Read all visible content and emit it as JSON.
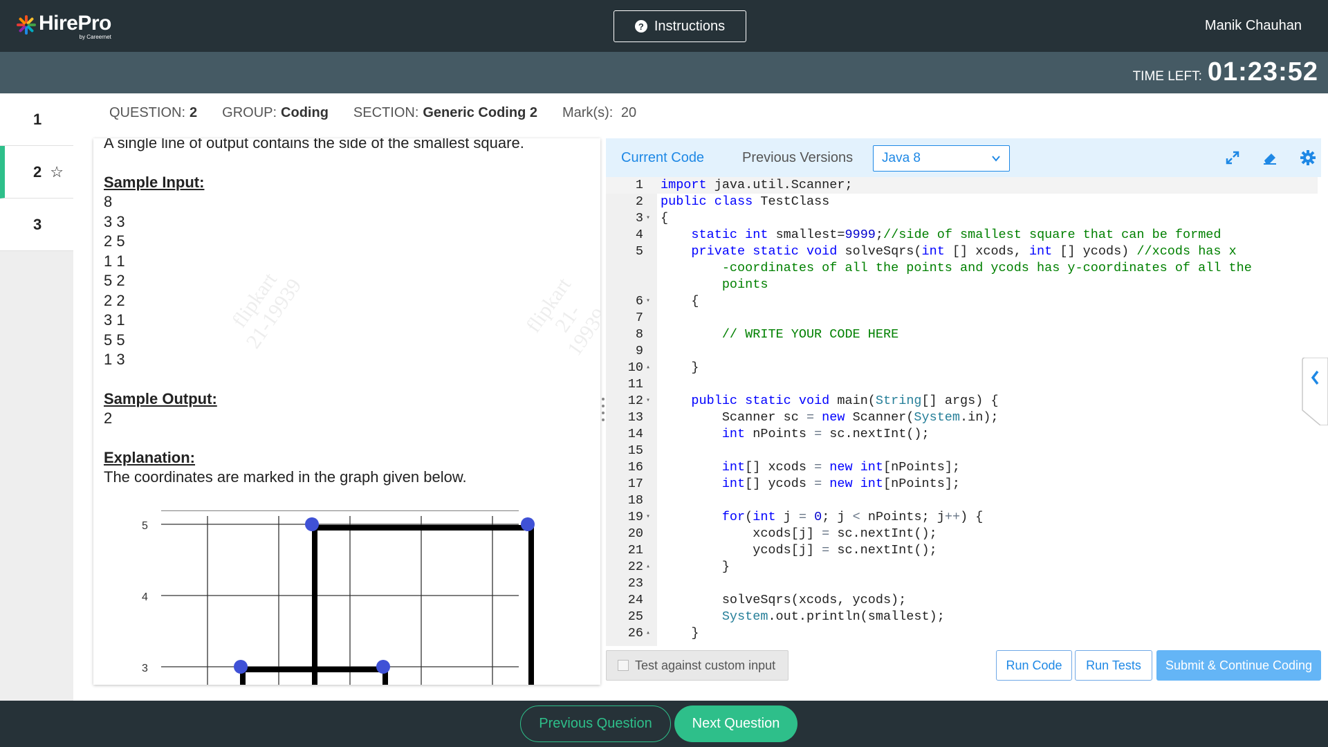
{
  "header": {
    "brand": "HirePro",
    "brand_sub": "by Careernet",
    "instructions_label": "Instructions",
    "user_name": "Manik Chauhan"
  },
  "timer": {
    "label": "TIME LEFT:",
    "value": "01:23:52"
  },
  "question_nav": {
    "items": [
      "1",
      "2",
      "3"
    ],
    "active": "2"
  },
  "meta": {
    "question_label": "QUESTION:",
    "question_value": "2",
    "group_label": "GROUP:",
    "group_value": "Coding",
    "section_label": "SECTION:",
    "section_value": "Generic Coding 2",
    "marks_label": "Mark(s):",
    "marks_value": "20"
  },
  "problem": {
    "output_line": "A single line of output contains the side of the smallest square.",
    "sample_input_heading": "Sample Input:",
    "sample_input": [
      "8",
      "3 3",
      "2 5",
      "1 1",
      "5 2",
      "2 2",
      "3 1",
      "5 5",
      "1 3"
    ],
    "sample_output_heading": "Sample Output:",
    "sample_output": "2",
    "explanation_heading": "Explanation:",
    "explanation_text": "The coordinates are marked in the graph given below.",
    "watermark_line1": "flipkart",
    "watermark_line2": "21-19939",
    "graph_y_ticks": [
      "5",
      "4",
      "3"
    ]
  },
  "editor": {
    "tab_current": "Current Code",
    "tab_previous": "Previous Versions",
    "language": "Java 8",
    "lines": [
      {
        "n": "1",
        "fold": "",
        "html": "<span class=\"kw\">import</span> java.util.Scanner;"
      },
      {
        "n": "2",
        "fold": "",
        "html": "<span class=\"kw\">public class</span> TestClass"
      },
      {
        "n": "3",
        "fold": "▾",
        "html": "{"
      },
      {
        "n": "4",
        "fold": "",
        "html": "    <span class=\"kw\">static</span> <span class=\"typ\">int</span> smallest=<span class=\"num\">9999</span>;<span class=\"cm\">//side of smallest square that can be formed</span>"
      },
      {
        "n": "5",
        "fold": "",
        "html": "    <span class=\"kw\">private static</span> <span class=\"typ\">void</span> solveSqrs(<span class=\"typ\">int</span> [] xcods, <span class=\"typ\">int</span> [] ycods) <span class=\"cm\">//xcods has x</span>"
      },
      {
        "n": "",
        "fold": "",
        "html": "        <span class=\"cm\">-coordinates of all the points and ycods has y-coordinates of all the</span>"
      },
      {
        "n": "",
        "fold": "",
        "html": "        <span class=\"cm\">points</span>"
      },
      {
        "n": "6",
        "fold": "▾",
        "html": "    {"
      },
      {
        "n": "7",
        "fold": "",
        "html": ""
      },
      {
        "n": "8",
        "fold": "",
        "html": "        <span class=\"cm\">// WRITE YOUR CODE HERE</span>"
      },
      {
        "n": "9",
        "fold": "",
        "html": ""
      },
      {
        "n": "10",
        "fold": "▴",
        "html": "    }"
      },
      {
        "n": "11",
        "fold": "",
        "html": ""
      },
      {
        "n": "12",
        "fold": "▾",
        "html": "    <span class=\"kw\">public static</span> <span class=\"typ\">void</span> main(<span class=\"cls\">String</span>[] args) {"
      },
      {
        "n": "13",
        "fold": "",
        "html": "        Scanner sc <span class=\"op\">=</span> <span class=\"kw\">new</span> Scanner(<span class=\"cls\">System</span>.in);"
      },
      {
        "n": "14",
        "fold": "",
        "html": "        <span class=\"typ\">int</span> nPoints <span class=\"op\">=</span> sc.nextInt();"
      },
      {
        "n": "15",
        "fold": "",
        "html": ""
      },
      {
        "n": "16",
        "fold": "",
        "html": "        <span class=\"typ\">int</span>[] xcods <span class=\"op\">=</span> <span class=\"kw\">new</span> <span class=\"typ\">int</span>[nPoints];"
      },
      {
        "n": "17",
        "fold": "",
        "html": "        <span class=\"typ\">int</span>[] ycods <span class=\"op\">=</span> <span class=\"kw\">new</span> <span class=\"typ\">int</span>[nPoints];"
      },
      {
        "n": "18",
        "fold": "",
        "html": ""
      },
      {
        "n": "19",
        "fold": "▾",
        "html": "        <span class=\"kw\">for</span>(<span class=\"typ\">int</span> j <span class=\"op\">=</span> <span class=\"num\">0</span>; j <span class=\"op\">&lt;</span> nPoints; j<span class=\"op\">++</span>) {"
      },
      {
        "n": "20",
        "fold": "",
        "html": "            xcods[j] <span class=\"op\">=</span> sc.nextInt();"
      },
      {
        "n": "21",
        "fold": "",
        "html": "            ycods[j] <span class=\"op\">=</span> sc.nextInt();"
      },
      {
        "n": "22",
        "fold": "▴",
        "html": "        }"
      },
      {
        "n": "23",
        "fold": "",
        "html": ""
      },
      {
        "n": "24",
        "fold": "",
        "html": "        solveSqrs(xcods, ycods);"
      },
      {
        "n": "25",
        "fold": "",
        "html": "        <span class=\"cls\">System</span>.out.println(smallest);"
      },
      {
        "n": "26",
        "fold": "▴",
        "html": "    }"
      }
    ],
    "custom_input_label": "Test against custom input",
    "run_code_label": "Run Code",
    "run_tests_label": "Run Tests",
    "submit_label": "Submit & Continue Coding"
  },
  "footer": {
    "prev_label": "Previous Question",
    "next_label": "Next Question"
  },
  "colors": {
    "topbar": "#263238",
    "timerbar": "#455a64",
    "accent_green": "#2ebf8a",
    "accent_blue": "#1e88e5",
    "point_blue": "#3f51d6"
  }
}
